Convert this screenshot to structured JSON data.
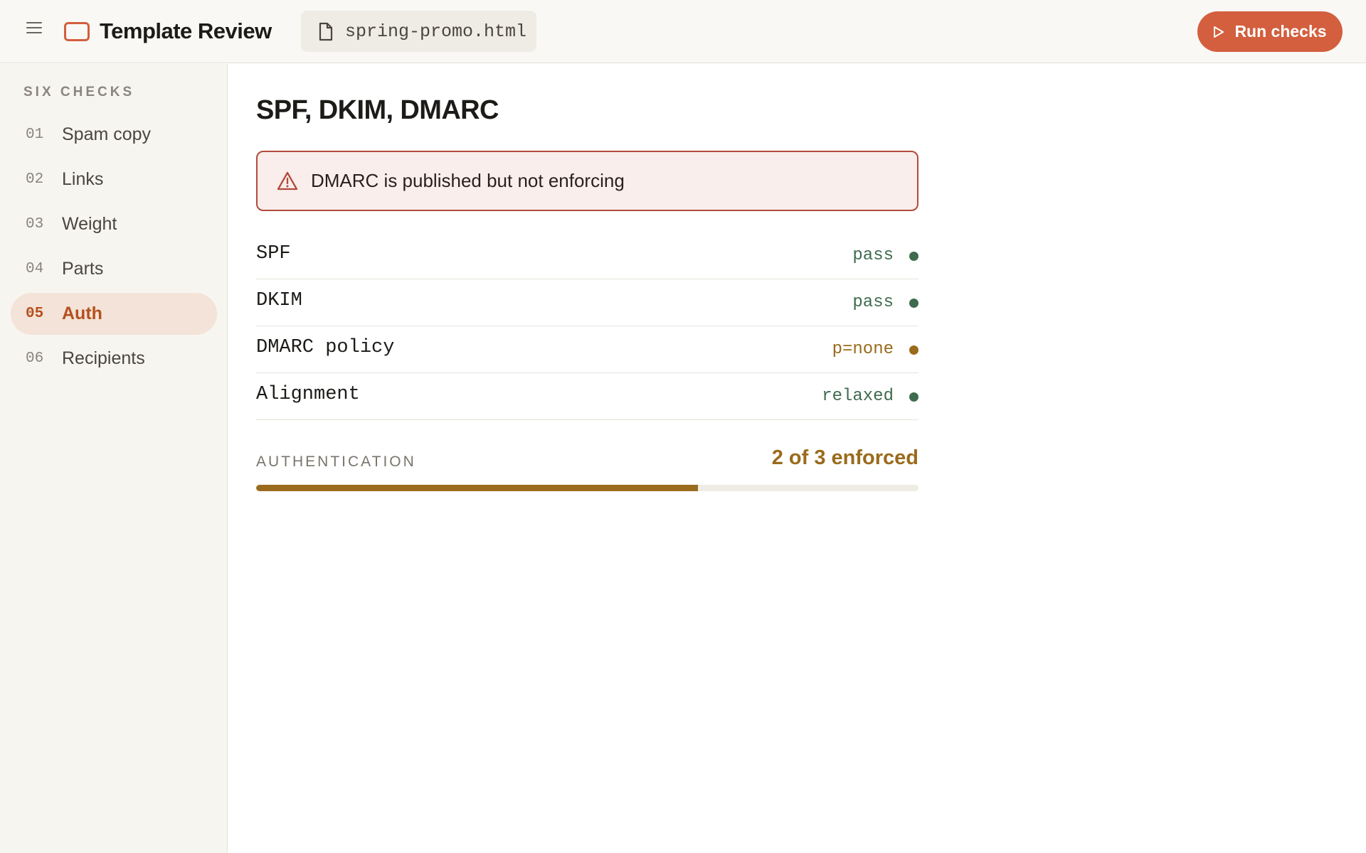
{
  "header": {
    "menu_icon": "hamburger-menu-icon",
    "logo_icon": "rounded-rectangle-logo-icon",
    "app_title": "Template Review",
    "file_icon": "document-icon",
    "file_name": "spring-promo.html",
    "run_button": {
      "icon": "play-icon",
      "label": "Run checks"
    }
  },
  "sidebar": {
    "heading": "SIX CHECKS",
    "items": [
      {
        "num": "01",
        "label": "Spam copy",
        "active": false
      },
      {
        "num": "02",
        "label": "Links",
        "active": false
      },
      {
        "num": "03",
        "label": "Weight",
        "active": false
      },
      {
        "num": "04",
        "label": "Parts",
        "active": false
      },
      {
        "num": "05",
        "label": "Auth",
        "active": true
      },
      {
        "num": "06",
        "label": "Recipients",
        "active": false
      }
    ]
  },
  "main": {
    "title": "SPF, DKIM, DMARC",
    "alert": {
      "icon": "warning-triangle-icon",
      "text": "DMARC is published but not enforcing"
    },
    "rows": [
      {
        "key": "SPF",
        "value": "pass",
        "status": "ok"
      },
      {
        "key": "DKIM",
        "value": "pass",
        "status": "ok"
      },
      {
        "key": "DMARC policy",
        "value": "p=none",
        "status": "warn"
      },
      {
        "key": "Alignment",
        "value": "relaxed",
        "status": "ok"
      }
    ],
    "summary": {
      "label": "AUTHENTICATION",
      "value": "2 of 3 enforced",
      "enforced": 2,
      "total": 3
    }
  },
  "colors": {
    "accent": "#d35f3e",
    "active_text": "#b5501f",
    "active_bg": "#f3e3d8",
    "ok": "#3e6b4e",
    "warn": "#9a6b1c",
    "alert_border": "#b24a3c",
    "alert_bg": "#f9eeeb"
  }
}
